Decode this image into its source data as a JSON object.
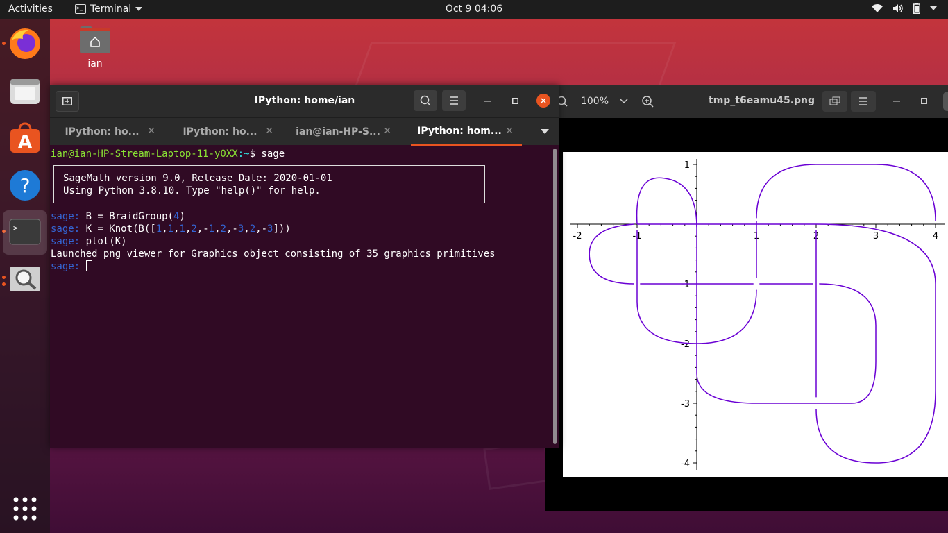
{
  "topbar": {
    "activities": "Activities",
    "app_name": "Terminal",
    "clock": "Oct 9  04:06"
  },
  "desktop": {
    "home_label": "ian"
  },
  "terminal": {
    "title": "IPython: home/ian",
    "tabs": [
      {
        "label": "IPython: ho..."
      },
      {
        "label": "IPython: ho..."
      },
      {
        "label": "ian@ian-HP-S..."
      },
      {
        "label": "IPython: hom..."
      }
    ],
    "lines": {
      "user_host": "ian@ian-HP-Stream-Laptop-11-y0XX",
      "path": ":~",
      "cmd1": "$ sage",
      "banner1": "SageMath version 9.0, Release Date: 2020-01-01",
      "banner2": "Using Python 3.8.10. Type \"help()\" for help.",
      "prompt": "sage: ",
      "cmd2_a": "B = BraidGroup(",
      "cmd2_n": "4",
      "cmd2_b": ")",
      "cmd3_a": "K = Knot(B([",
      "cmd3_b": "]))",
      "cmd4": "plot(K)",
      "output": "Launched png viewer for Graphics object consisting of 35 graphics primitives"
    },
    "braid_word": [
      "1",
      "1",
      "1",
      "2",
      "-1",
      "2",
      "-3",
      "2",
      "-3"
    ]
  },
  "viewer": {
    "zoom": "100%",
    "title": "tmp_t6eamu45.png"
  },
  "chart_data": {
    "type": "line",
    "title": "",
    "xlim": [
      -2,
      4
    ],
    "ylim": [
      -4,
      1
    ],
    "x_ticks": [
      "-2",
      "-1",
      "1",
      "2",
      "3",
      "4"
    ],
    "y_ticks": [
      "1",
      "-1",
      "-2",
      "-3",
      "-4"
    ],
    "series_color": "#6a00d4"
  },
  "colors": {
    "accent": "#e95420",
    "terminal_bg": "#300a24",
    "prompt": "#3465d4",
    "user_host": "#8ae234"
  }
}
